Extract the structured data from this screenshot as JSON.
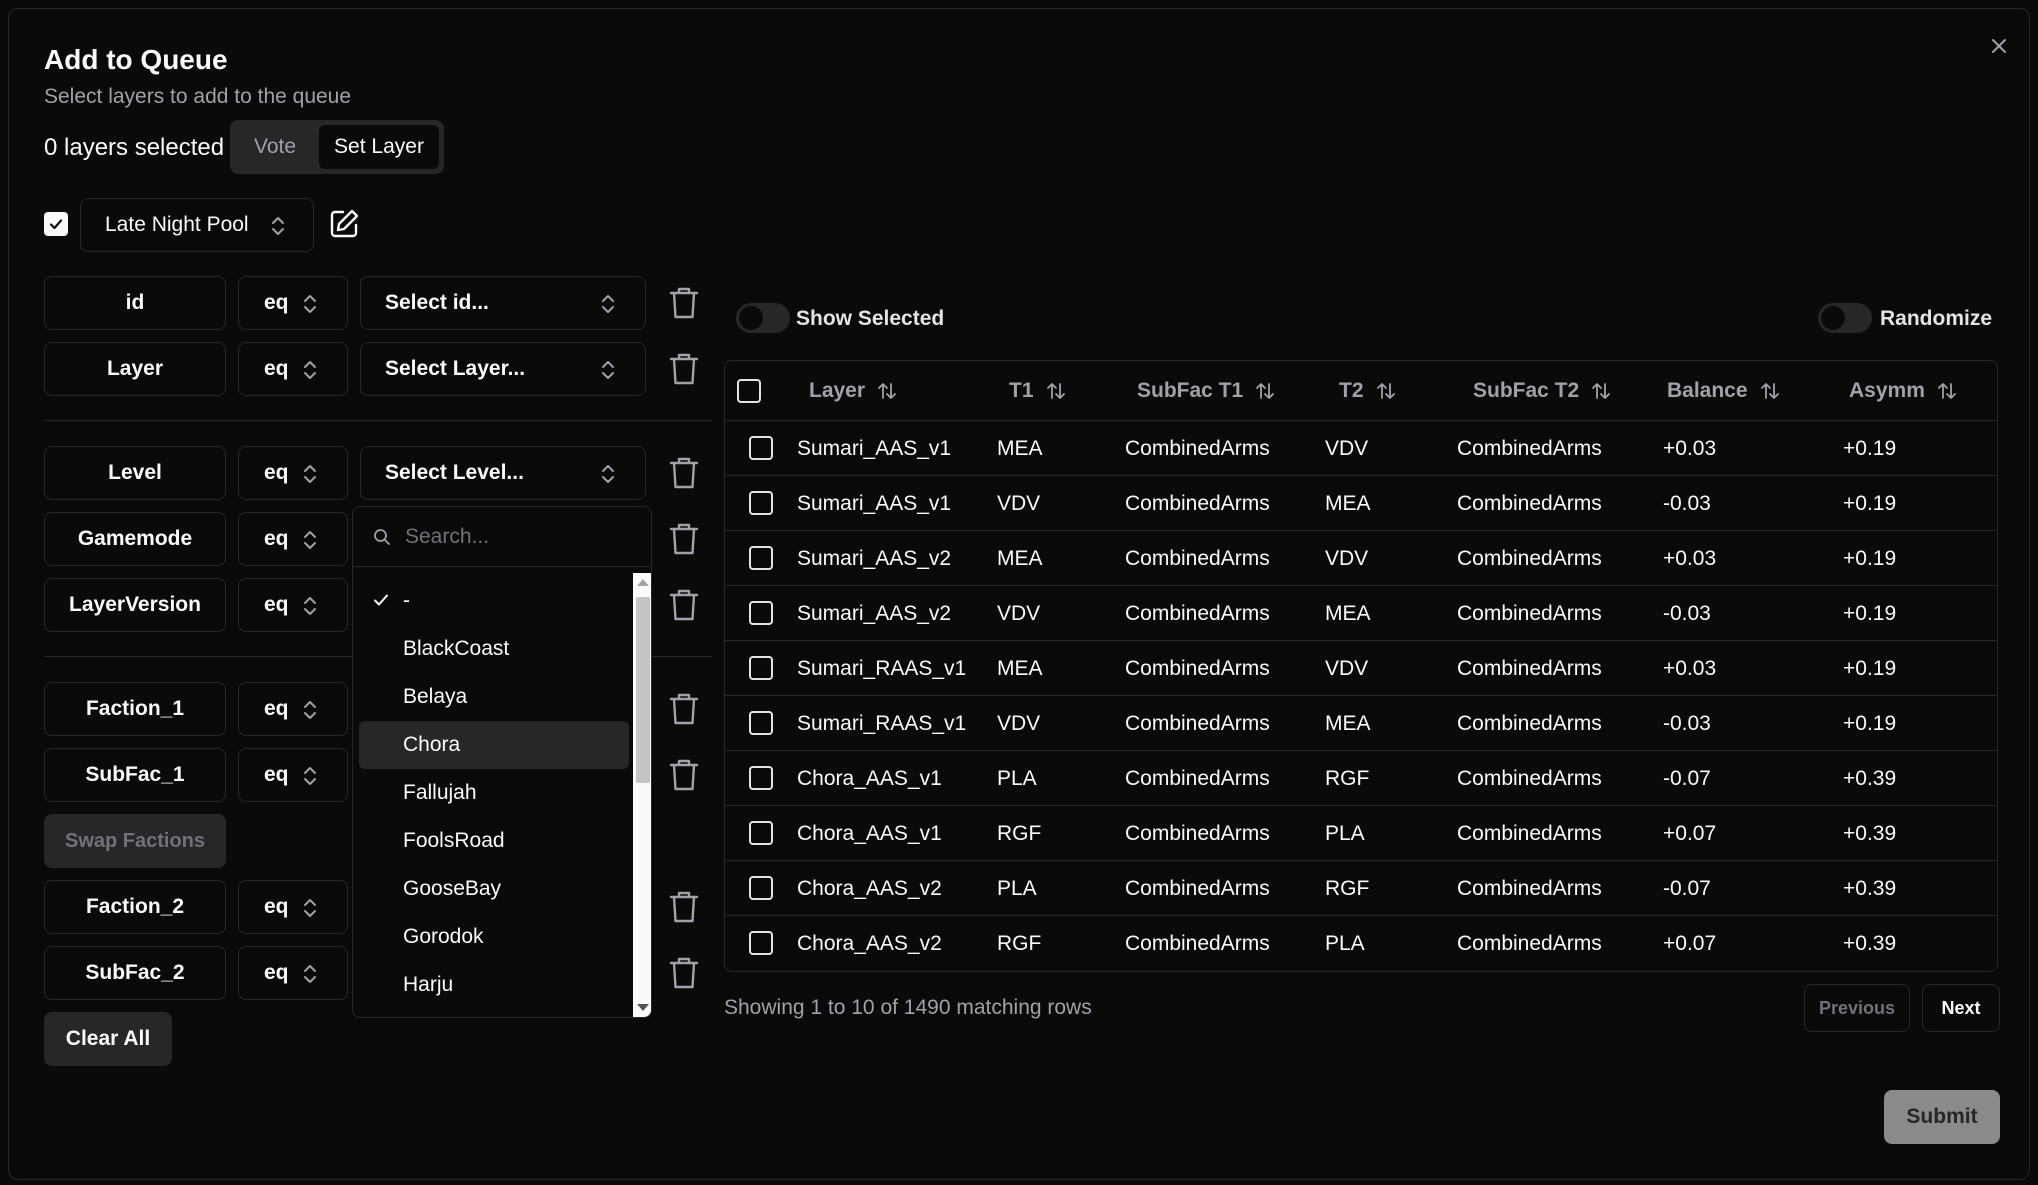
{
  "dialog": {
    "title": "Add to Queue",
    "subtitle": "Select layers to add to the queue",
    "selected_count": "0 layers selected",
    "mode_options": [
      "Vote",
      "Set Layer"
    ],
    "active_mode": "Set Layer"
  },
  "pool": {
    "checked": true,
    "label": "Late Night Pool"
  },
  "filters": [
    {
      "field": "id",
      "op": "eq",
      "value": "Select id..."
    },
    {
      "field": "Layer",
      "op": "eq",
      "value": "Select Layer..."
    },
    {
      "field": "Level",
      "op": "eq",
      "value": "Select Level..."
    },
    {
      "field": "Gamemode",
      "op": "eq",
      "value": ""
    },
    {
      "field": "LayerVersion",
      "op": "eq",
      "value": ""
    },
    {
      "field": "Faction_1",
      "op": "eq",
      "value": ""
    },
    {
      "field": "SubFac_1",
      "op": "eq",
      "value": ""
    },
    {
      "field": "Faction_2",
      "op": "eq",
      "value": ""
    },
    {
      "field": "SubFac_2",
      "op": "eq",
      "value": ""
    }
  ],
  "swap_label": "Swap Factions",
  "clear_label": "Clear All",
  "dropdown": {
    "search_placeholder": "Search...",
    "items": [
      "-",
      "BlackCoast",
      "Belaya",
      "Chora",
      "Fallujah",
      "FoolsRoad",
      "GooseBay",
      "Gorodok",
      "Harju"
    ],
    "selected": "-",
    "highlighted": "Chora"
  },
  "table_controls": {
    "show_selected_label": "Show Selected",
    "show_selected_on": false,
    "randomize_label": "Randomize",
    "randomize_on": false
  },
  "table": {
    "columns": [
      "Layer",
      "T1",
      "SubFac T1",
      "T2",
      "SubFac T2",
      "Balance",
      "Asymm"
    ],
    "rows": [
      [
        "Sumari_AAS_v1",
        "MEA",
        "CombinedArms",
        "VDV",
        "CombinedArms",
        "+0.03",
        "+0.19"
      ],
      [
        "Sumari_AAS_v1",
        "VDV",
        "CombinedArms",
        "MEA",
        "CombinedArms",
        "-0.03",
        "+0.19"
      ],
      [
        "Sumari_AAS_v2",
        "MEA",
        "CombinedArms",
        "VDV",
        "CombinedArms",
        "+0.03",
        "+0.19"
      ],
      [
        "Sumari_AAS_v2",
        "VDV",
        "CombinedArms",
        "MEA",
        "CombinedArms",
        "-0.03",
        "+0.19"
      ],
      [
        "Sumari_RAAS_v1",
        "MEA",
        "CombinedArms",
        "VDV",
        "CombinedArms",
        "+0.03",
        "+0.19"
      ],
      [
        "Sumari_RAAS_v1",
        "VDV",
        "CombinedArms",
        "MEA",
        "CombinedArms",
        "-0.03",
        "+0.19"
      ],
      [
        "Chora_AAS_v1",
        "PLA",
        "CombinedArms",
        "RGF",
        "CombinedArms",
        "-0.07",
        "+0.39"
      ],
      [
        "Chora_AAS_v1",
        "RGF",
        "CombinedArms",
        "PLA",
        "CombinedArms",
        "+0.07",
        "+0.39"
      ],
      [
        "Chora_AAS_v2",
        "PLA",
        "CombinedArms",
        "RGF",
        "CombinedArms",
        "-0.07",
        "+0.39"
      ],
      [
        "Chora_AAS_v2",
        "RGF",
        "CombinedArms",
        "PLA",
        "CombinedArms",
        "+0.07",
        "+0.39"
      ]
    ],
    "showing_text": "Showing 1 to 10 of 1490 matching rows",
    "prev_label": "Previous",
    "next_label": "Next"
  },
  "submit_label": "Submit",
  "icons": {
    "close": "close-icon",
    "check": "check-icon",
    "chevrons": "chevrons-up-down-icon",
    "edit": "edit-icon",
    "trash": "trash-icon",
    "search": "search-icon",
    "sort": "sort-arrows-icon"
  }
}
